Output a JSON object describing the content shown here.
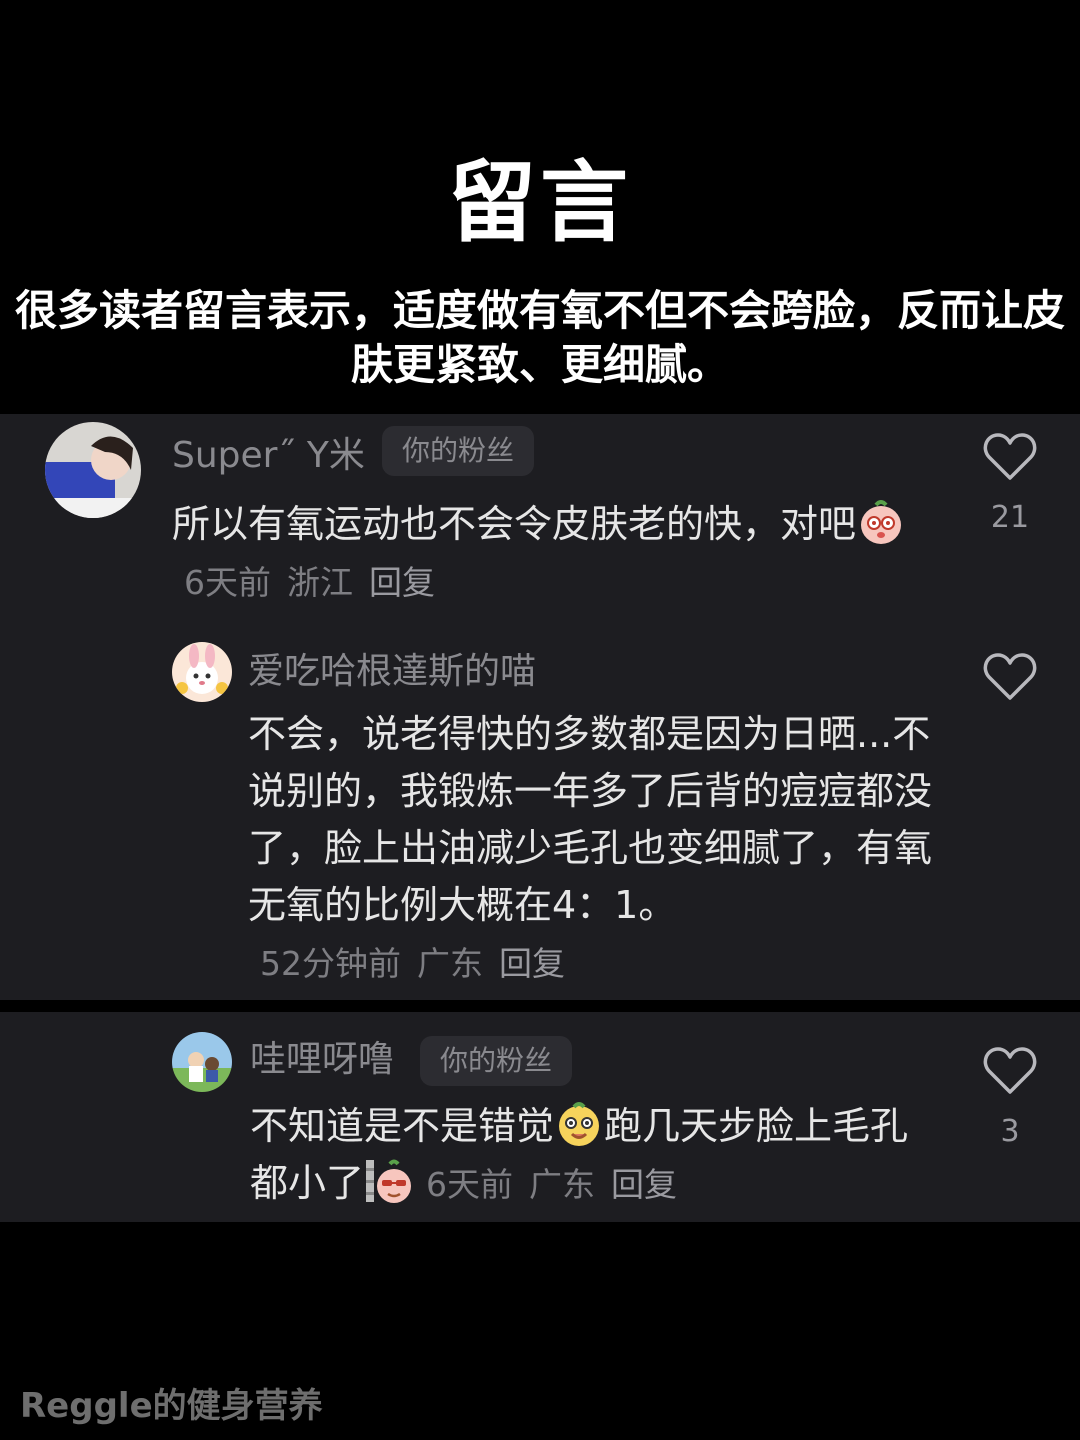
{
  "header": {
    "title": "留言",
    "subtitle": "很多读者留言表示，适度做有氧不但不会跨脸，反而让皮肤更紧致、更细腻。"
  },
  "comments": [
    {
      "username": "Super˝  Y米",
      "badge": "你的粉丝",
      "text": "所以有氧运动也不会令皮肤老的快，对吧",
      "time": "6天前",
      "location": "浙江",
      "reply": "回复",
      "likes": "21",
      "emoji_icon": "blushing-face-emoji"
    },
    {
      "username": "爱吃哈根達斯的喵",
      "text": "不会，说老得快的多数都是因为日晒...不说别的，我锻炼一年多了后背的痘痘都没了，脸上出油减少毛孔也变细腻了，有氧无氧的比例大概在4：1。",
      "time": "52分钟前",
      "location": "广东",
      "reply": "回复"
    },
    {
      "username": "哇哩呀噜",
      "badge": "你的粉丝",
      "text_a": "不知道是不是错觉",
      "text_b": "跑几天步脸上毛孔都小了",
      "time": "6天前",
      "location": "广东",
      "reply": "回复",
      "likes": "3",
      "emoji_icons": [
        "happy-face-emoji",
        "cool-face-emoji"
      ]
    }
  ],
  "watermark": "Reggle的健身营养",
  "colors": {
    "background": "#000000",
    "panel": "#1d1d21",
    "badge": "#2c2c31",
    "muted_text": "#8a8a8f"
  }
}
